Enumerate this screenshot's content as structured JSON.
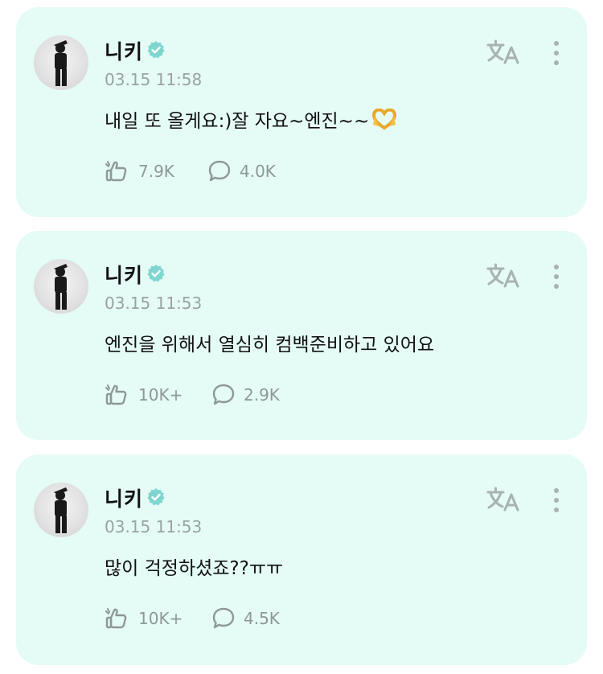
{
  "posts": [
    {
      "author": "니키",
      "time": "03.15 11:58",
      "text": "내일 또 올게요:)잘 자요~엔진~~",
      "emoji": "heart-hands",
      "likes": "7.9K",
      "comments": "4.0K"
    },
    {
      "author": "니키",
      "time": "03.15 11:53",
      "text": "엔진을 위해서 열심히 컴백준비하고 있어요",
      "likes": "10K+",
      "comments": "2.9K"
    },
    {
      "author": "니키",
      "time": "03.15 11:53",
      "text": "많이 걱정하셨죠??ㅠㅠ",
      "likes": "10K+",
      "comments": "4.5K"
    }
  ],
  "icons": {
    "verified": "verified-badge-icon",
    "translate": "translate-icon",
    "more": "more-vertical-icon",
    "like": "like-hand-icon",
    "comment": "comment-bubble-icon"
  },
  "colors": {
    "card_background": "#e5fbf6",
    "accent_teal": "#7fd6d0",
    "muted_text": "#9aa3a1"
  }
}
